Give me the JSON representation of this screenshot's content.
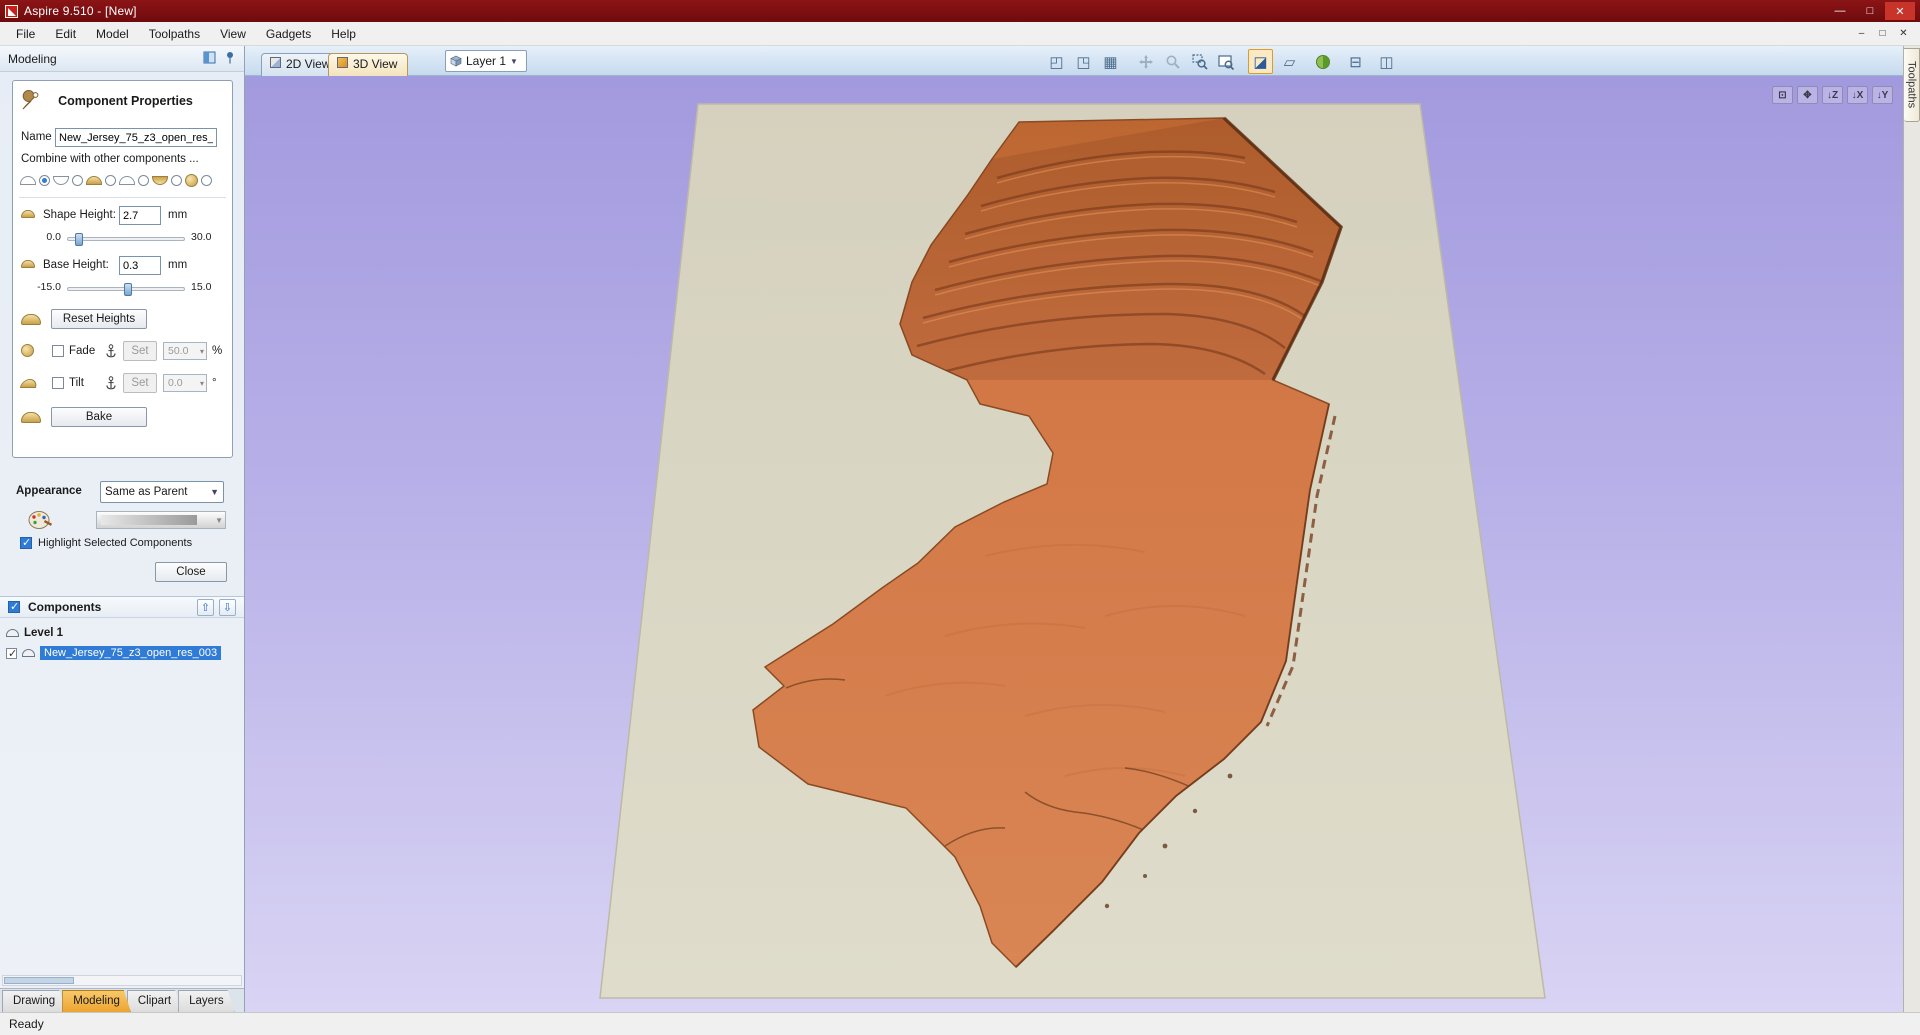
{
  "window": {
    "title": "Aspire 9.510 - [New]",
    "status": "Ready"
  },
  "menu": {
    "items": [
      "File",
      "Edit",
      "Model",
      "Toolpaths",
      "View",
      "Gadgets",
      "Help"
    ]
  },
  "panel": {
    "title": "Modeling",
    "props": {
      "title": "Component Properties",
      "name_label": "Name",
      "name_value": "New_Jersey_75_z3_open_res_003",
      "combine_label": "Combine with other components ...",
      "shape_height_label": "Shape Height:",
      "shape_height_value": "2.7",
      "shape_height_unit": "mm",
      "shape_height_min": "0.0",
      "shape_height_max": "30.0",
      "base_height_label": "Base Height:",
      "base_height_value": "0.3",
      "base_height_unit": "mm",
      "base_height_min": "-15.0",
      "base_height_max": "15.0",
      "reset_label": "Reset Heights",
      "fade_label": "Fade",
      "fade_set_label": "Set",
      "fade_value": "50.0",
      "fade_unit": "%",
      "tilt_label": "Tilt",
      "tilt_set_label": "Set",
      "tilt_value": "0.0",
      "tilt_unit": "°",
      "bake_label": "Bake",
      "appearance_label": "Appearance",
      "appearance_value": "Same as Parent",
      "highlight_label": "Highlight Selected Components",
      "close_label": "Close"
    },
    "components": {
      "title": "Components",
      "level_label": "Level 1",
      "item_label": "New_Jersey_75_z3_open_res_003"
    },
    "tabs": [
      "Drawing",
      "Modeling",
      "Clipart",
      "Layers"
    ],
    "active_tab": "Modeling"
  },
  "viewbar": {
    "tabs": [
      "2D View",
      "3D View"
    ],
    "active_tab": "3D View",
    "layer_label": "Layer 1"
  },
  "view_controls": {
    "z_label": "Z",
    "x_label": "X",
    "y_label": "Y"
  },
  "right_tab": "Toolpaths",
  "colors": {
    "titlebar": "#7a1012",
    "selection": "#2f7bd6",
    "active_tab": "#f2b24a",
    "terrain": "#d57a48",
    "ground_plane": "#d9d6c3",
    "sky_top": "#a29ade",
    "sky_bottom": "#d9d4f4"
  }
}
